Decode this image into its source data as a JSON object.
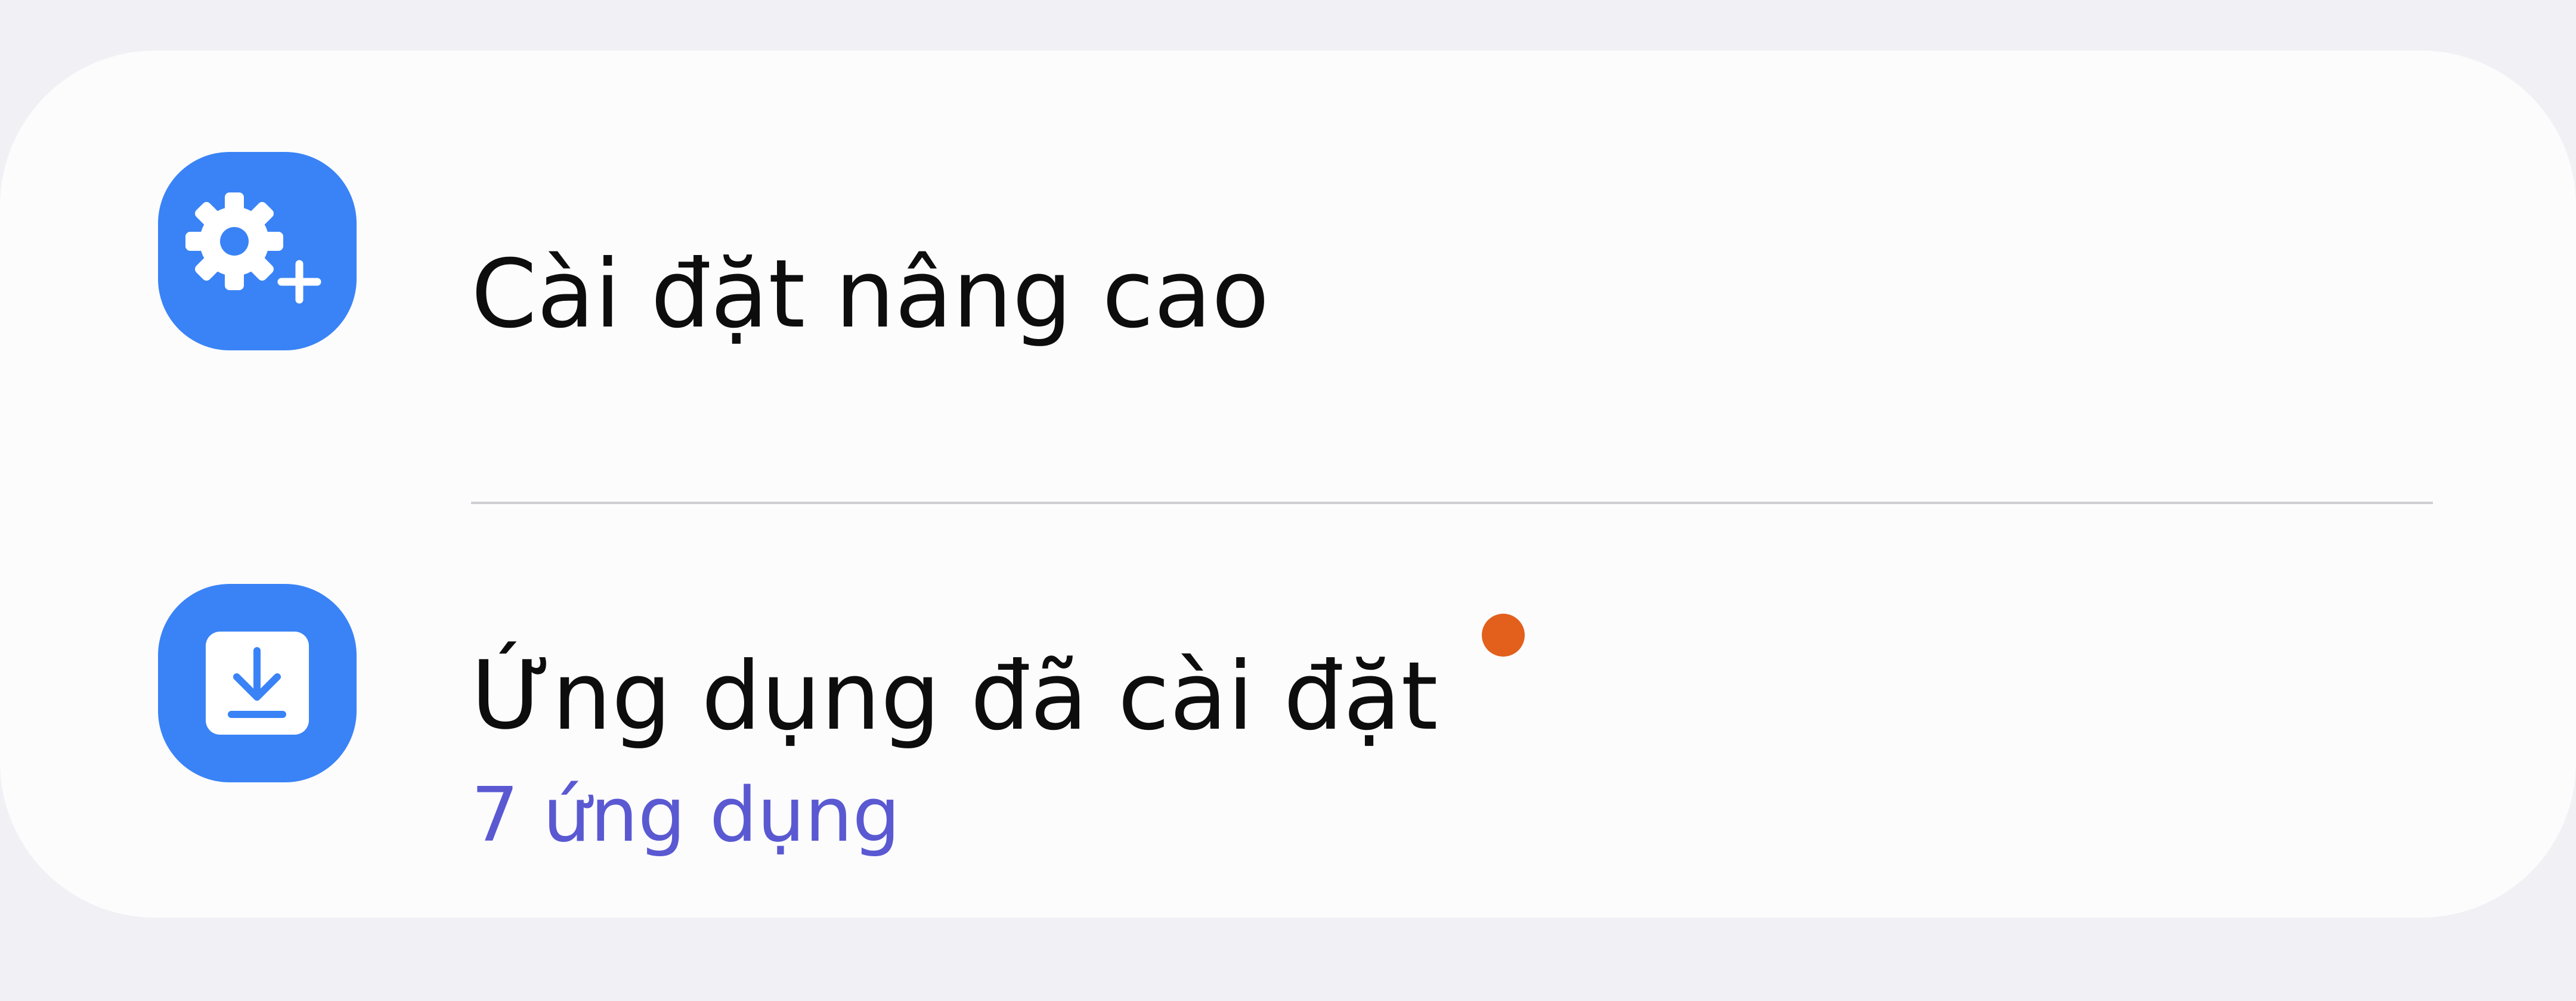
{
  "items": [
    {
      "icon": "gear-plus-icon",
      "title": "Cài đặt nâng cao"
    },
    {
      "icon": "download-box-icon",
      "title": "Ứng dụng đã cài đặt",
      "subtitle": "7 ứng dụng",
      "has_badge": true
    }
  ],
  "colors": {
    "background": "#f1f0f5",
    "card": "#fcfcfd",
    "icon_bg": "#3a83f6",
    "title_text": "#0d0d0d",
    "subtitle_text": "#5a59d2",
    "badge": "#e2601c",
    "divider": "#cfcfd3"
  }
}
